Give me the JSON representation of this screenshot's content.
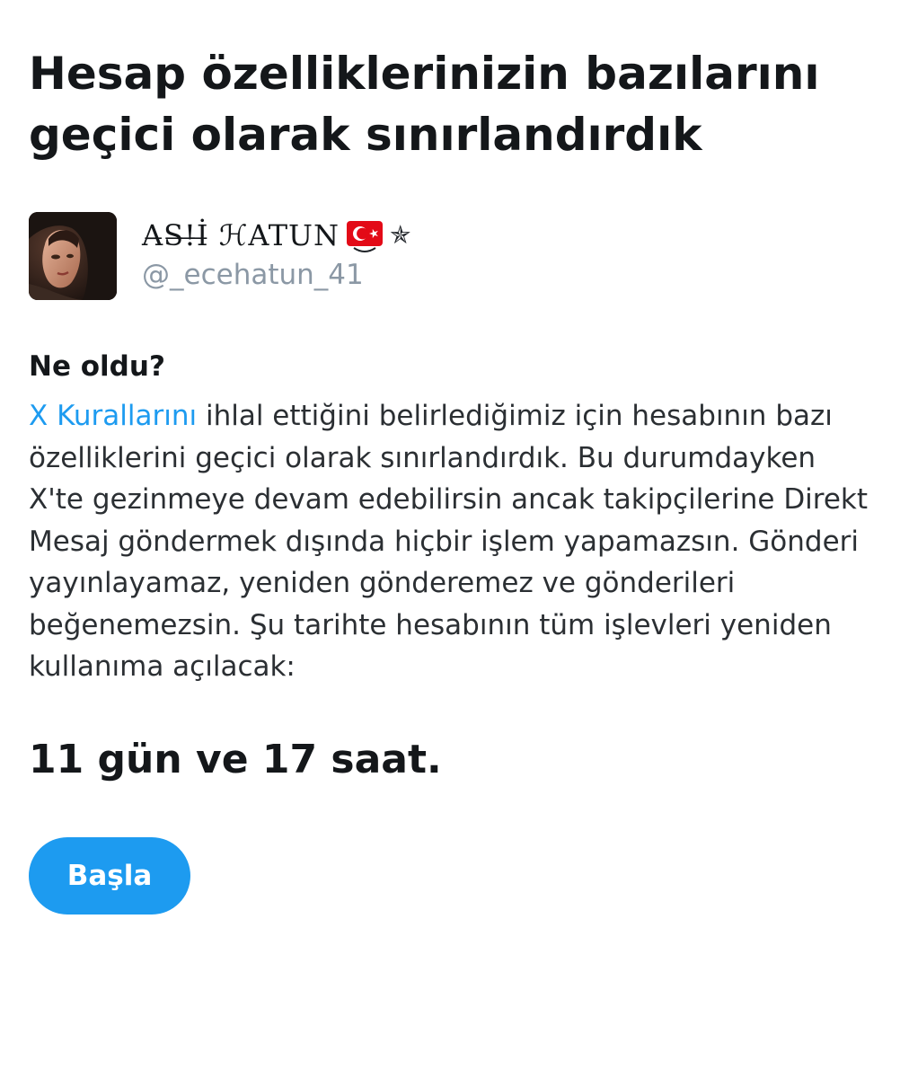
{
  "title": "Hesap özelliklerinizin bazılarını geçici olarak sınırlandırdık",
  "account": {
    "display_name": "A̶S̶!̶İ̶ ℋATUN",
    "handle": "@_ecehatun_41",
    "flag_icon": "turkey-flag-icon",
    "star_glyph": "✯"
  },
  "section": {
    "heading": "Ne oldu?",
    "link_text": "X Kurallarını",
    "body_text": " ihlal ettiğini belirlediğimiz için hesabının bazı özelliklerini geçici olarak sınırlandırdık. Bu durumdayken X'te gezinmeye devam edebilirsin ancak takipçilerine Direkt Mesaj göndermek dışında hiçbir işlem yapamazsın. Gönderi yayınlayamaz, yeniden gönderemez ve gönderileri beğenemezsin. Şu tarihte hesabının tüm işlevleri yeniden kullanıma açılacak:"
  },
  "countdown": "11 gün ve 17 saat.",
  "button": {
    "label": "Başla"
  },
  "colors": {
    "accent": "#1d9bf0",
    "text_primary": "#14171a",
    "text_secondary": "#8b98a5",
    "flag_red": "#e30a17"
  }
}
